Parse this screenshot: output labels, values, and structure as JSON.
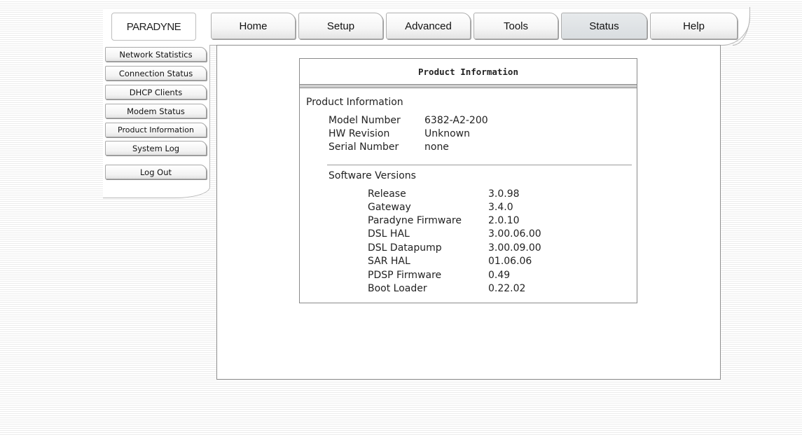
{
  "brand": {
    "logo_text": "PARADYNE"
  },
  "nav": {
    "tabs": [
      {
        "label": "Home"
      },
      {
        "label": "Setup"
      },
      {
        "label": "Advanced"
      },
      {
        "label": "Tools"
      },
      {
        "label": "Status",
        "active": true
      },
      {
        "label": "Help"
      }
    ]
  },
  "sidebar": {
    "items": [
      {
        "label": "Network Statistics"
      },
      {
        "label": "Connection Status"
      },
      {
        "label": "DHCP Clients"
      },
      {
        "label": "Modem Status"
      },
      {
        "label": "Product Information",
        "active": true
      },
      {
        "label": "System Log"
      }
    ],
    "logout_label": "Log Out"
  },
  "product_info": {
    "box_title": "Product Information",
    "section_title": "Product Information",
    "fields": [
      {
        "label": "Model Number",
        "value": "6382-A2-200"
      },
      {
        "label": "HW Revision",
        "value": "Unknown"
      },
      {
        "label": "Serial Number",
        "value": "none"
      }
    ],
    "software_title": "Software Versions",
    "software": [
      {
        "label": "Release",
        "value": "3.0.98"
      },
      {
        "label": "Gateway",
        "value": "3.4.0"
      },
      {
        "label": "Paradyne Firmware",
        "value": "2.0.10"
      },
      {
        "label": "DSL HAL",
        "value": "3.00.06.00"
      },
      {
        "label": "DSL Datapump",
        "value": "3.00.09.00"
      },
      {
        "label": "SAR HAL",
        "value": "01.06.06"
      },
      {
        "label": "PDSP Firmware",
        "value": "0.49"
      },
      {
        "label": "Boot Loader",
        "value": "0.22.02"
      }
    ]
  },
  "colors": {
    "active_tab_bg": "#d9dde0",
    "page_stripe": "#ececec",
    "border": "#8e8e8e"
  }
}
